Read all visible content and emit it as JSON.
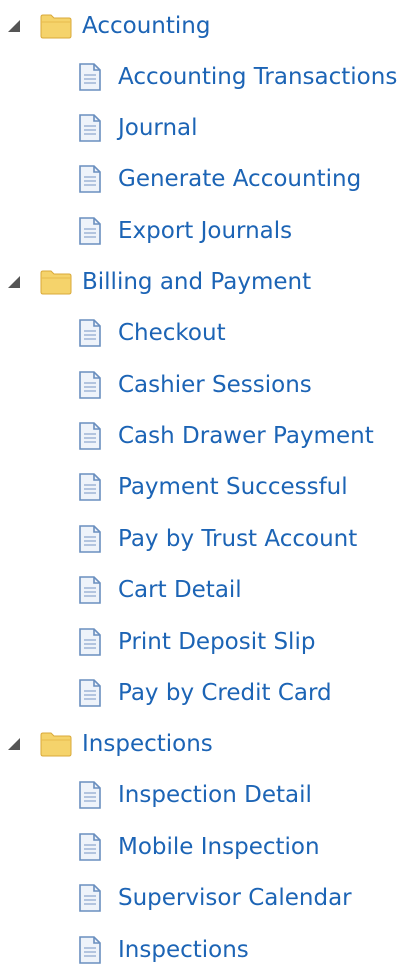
{
  "tree": [
    {
      "label": "Accounting",
      "expanded": true,
      "icon": "folder-icon",
      "children": [
        {
          "label": "Accounting Transactions",
          "icon": "page-icon"
        },
        {
          "label": "Journal",
          "icon": "page-icon"
        },
        {
          "label": "Generate Accounting",
          "icon": "page-icon"
        },
        {
          "label": "Export Journals",
          "icon": "page-icon"
        }
      ]
    },
    {
      "label": "Billing and Payment",
      "expanded": true,
      "icon": "folder-icon",
      "children": [
        {
          "label": "Checkout",
          "icon": "page-icon"
        },
        {
          "label": "Cashier Sessions",
          "icon": "page-icon"
        },
        {
          "label": "Cash Drawer Payment",
          "icon": "page-icon"
        },
        {
          "label": "Payment Successful",
          "icon": "page-icon"
        },
        {
          "label": "Pay by Trust Account",
          "icon": "page-icon"
        },
        {
          "label": "Cart Detail",
          "icon": "page-icon"
        },
        {
          "label": "Print Deposit Slip",
          "icon": "page-icon"
        },
        {
          "label": "Pay by Credit Card",
          "icon": "page-icon"
        }
      ]
    },
    {
      "label": "Inspections",
      "expanded": true,
      "icon": "folder-icon",
      "children": [
        {
          "label": "Inspection Detail",
          "icon": "page-icon"
        },
        {
          "label": "Mobile Inspection",
          "icon": "page-icon"
        },
        {
          "label": "Supervisor Calendar",
          "icon": "page-icon"
        },
        {
          "label": "Inspections",
          "icon": "page-icon"
        }
      ]
    }
  ],
  "colors": {
    "link": "#1c64b5",
    "toggle": "#555555",
    "folder_fill": "#f5d36b",
    "folder_edge": "#d9a93a",
    "page_fill": "#eef3fa",
    "page_edge": "#6a8fbf"
  }
}
